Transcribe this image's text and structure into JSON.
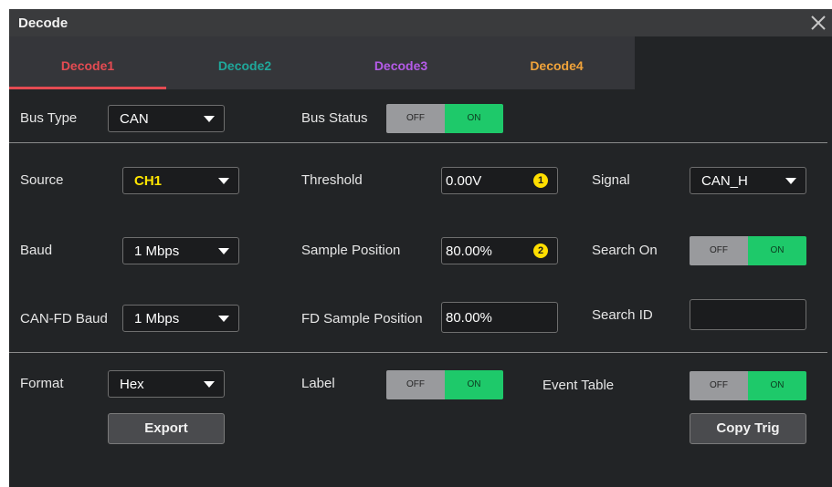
{
  "window": {
    "title": "Decode"
  },
  "tabs": [
    {
      "label": "Decode1",
      "color": "#e54b52",
      "active": true
    },
    {
      "label": "Decode2",
      "color": "#1fa89b",
      "active": false
    },
    {
      "label": "Decode3",
      "color": "#b55be8",
      "active": false
    },
    {
      "label": "Decode4",
      "color": "#f0a33a",
      "active": false
    }
  ],
  "bus": {
    "type_label": "Bus Type",
    "type_value": "CAN",
    "status_label": "Bus Status",
    "status_off": "OFF",
    "status_on": "ON"
  },
  "source": {
    "label": "Source",
    "value": "CH1",
    "value_color": "#ffe500"
  },
  "threshold": {
    "label": "Threshold",
    "value": "0.00V",
    "badge": "1"
  },
  "signal": {
    "label": "Signal",
    "value": "CAN_H"
  },
  "baud": {
    "label": "Baud",
    "value": "1 Mbps"
  },
  "sample_position": {
    "label": "Sample Position",
    "value": "80.00%",
    "badge": "2"
  },
  "search_on": {
    "label": "Search On",
    "off": "OFF",
    "on": "ON"
  },
  "canfd_baud": {
    "label": "CAN-FD Baud",
    "value": "1 Mbps"
  },
  "fd_sample_position": {
    "label": "FD Sample Position",
    "value": "80.00%"
  },
  "search_id": {
    "label": "Search ID",
    "value": ""
  },
  "format": {
    "label": "Format",
    "value": "Hex"
  },
  "label_toggle": {
    "label": "Label",
    "off": "OFF",
    "on": "ON"
  },
  "event_table": {
    "label": "Event Table",
    "off": "OFF",
    "on": "ON"
  },
  "buttons": {
    "export": "Export",
    "copy_trig": "Copy Trig"
  }
}
